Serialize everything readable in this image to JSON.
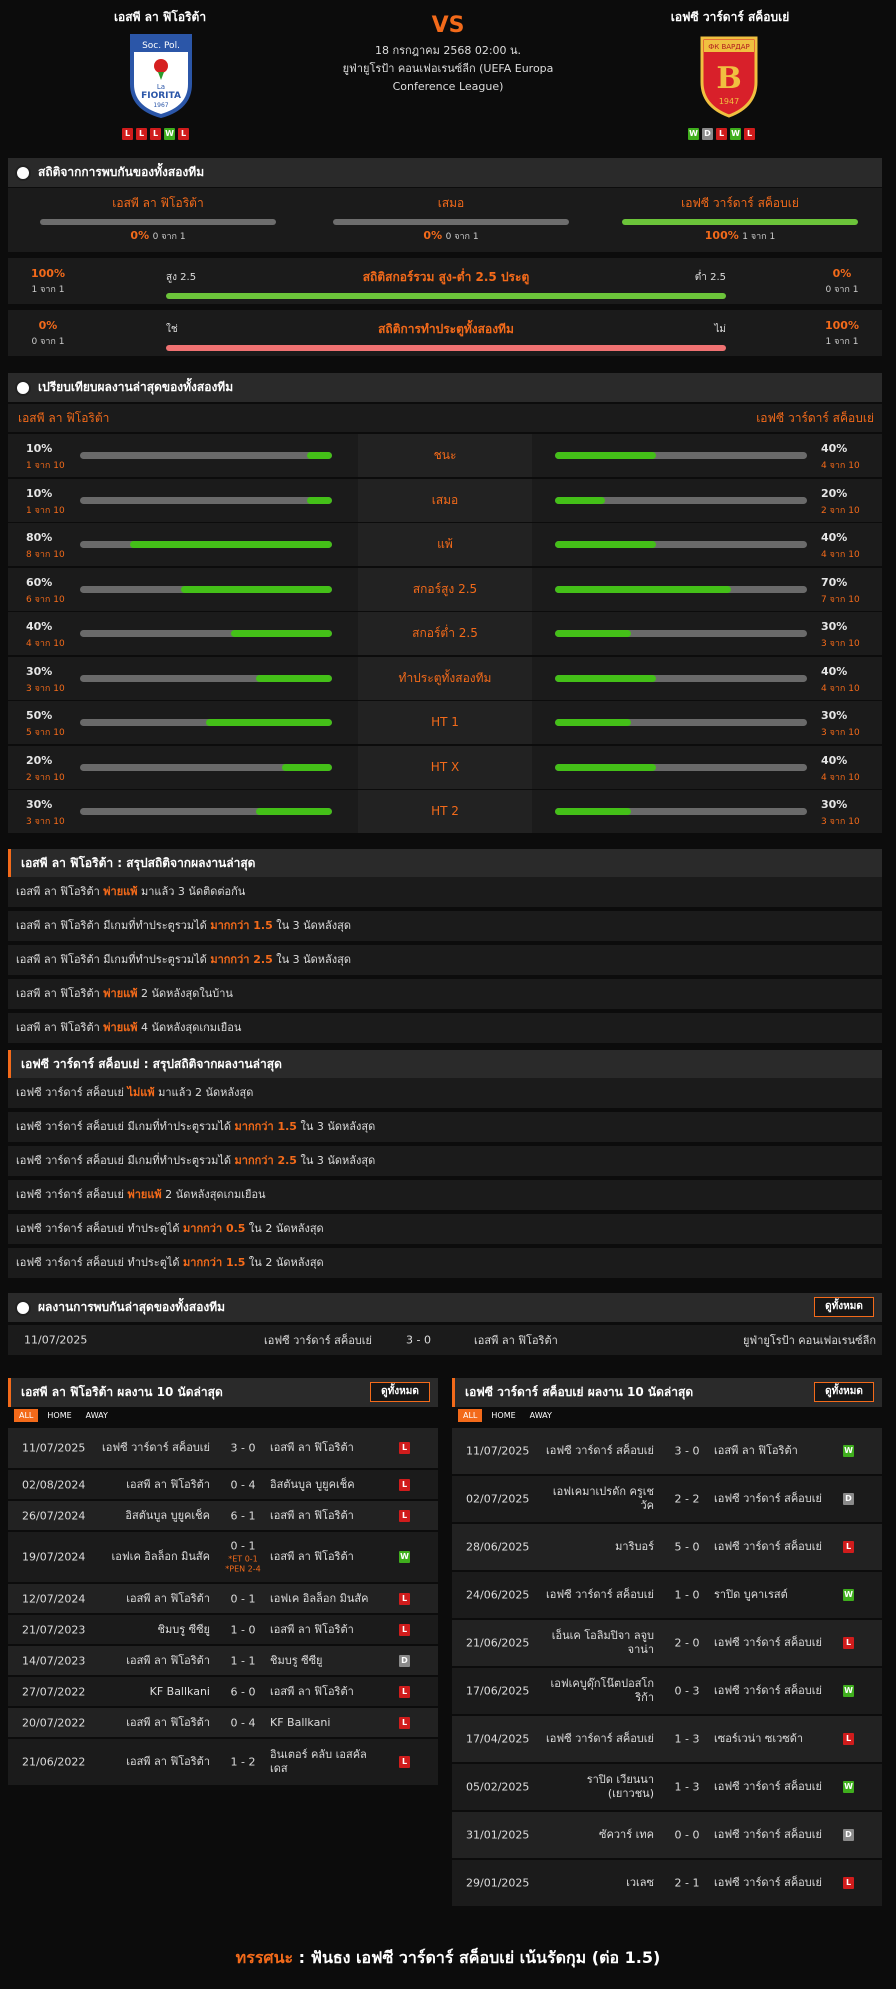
{
  "match": {
    "home": "เอสพี ลา ฟิโอริต้า",
    "away": "เอฟซี วาร์ดาร์ สค็อบเย่",
    "vs": "VS",
    "date": "18 กรกฎาคม 2568 02:00 น.",
    "league": "ยูฟ่ายูโรป้า คอนเฟอเรนซ์ลีก (UEFA Europa Conference League)",
    "home_form": [
      "L",
      "L",
      "L",
      "W",
      "L"
    ],
    "away_form": [
      "W",
      "D",
      "L",
      "W",
      "L"
    ],
    "home_logo_text": [
      "Soc. Pol.",
      "La",
      "FIORITA",
      "1967"
    ],
    "away_logo_text": [
      "ФК ВАРДАР",
      "B",
      "1947"
    ]
  },
  "h2h_stats": {
    "title": "สถิติจากการพบกันของทั้งสองทีม",
    "cols": [
      {
        "name": "เอสพี ลา ฟิโอริต้า",
        "pct": "0%",
        "of": "0 จาก 1",
        "fill": 0
      },
      {
        "name": "เสมอ",
        "pct": "0%",
        "of": "0 จาก 1",
        "fill": 0
      },
      {
        "name": "เอฟซี วาร์ดาร์ สค็อบเย่",
        "pct": "100%",
        "of": "1 จาก 1",
        "fill": 1
      }
    ],
    "ou": {
      "left": "100%",
      "left_of": "1 จาก 1",
      "a": "สูง 2.5",
      "title": "สถิติสกอร์รวม สูง-ต่ำ 2.5 ประตู",
      "b": "ต่ำ 2.5",
      "right": "0%",
      "right_of": "0 จาก 1",
      "color": "#6cc43a"
    },
    "btts": {
      "left": "0%",
      "left_of": "0 จาก 1",
      "a": "ใช่",
      "title": "สถิติการทำประตูทั้งสองทีม",
      "b": "ไม่",
      "right": "100%",
      "right_of": "1 จาก 1",
      "color": "#f07272"
    }
  },
  "compare": {
    "title": "เปรียบเทียบผลงานล่าสุดของทั้งสองทีม",
    "home": "เอสพี ลา ฟิโอริต้า",
    "away": "เอฟซี วาร์ดาร์ สค็อบเย่",
    "rows": [
      {
        "label": "ชนะ",
        "hp": "10%",
        "hof": "1 จาก 10",
        "hv": 0.1,
        "ap": "40%",
        "aof": "4 จาก 10",
        "av": 0.4
      },
      {
        "label": "เสมอ",
        "hp": "10%",
        "hof": "1 จาก 10",
        "hv": 0.1,
        "ap": "20%",
        "aof": "2 จาก 10",
        "av": 0.2
      },
      {
        "label": "แพ้",
        "hp": "80%",
        "hof": "8 จาก 10",
        "hv": 0.8,
        "ap": "40%",
        "aof": "4 จาก 10",
        "av": 0.4
      },
      {
        "label": "สกอร์สูง 2.5",
        "hp": "60%",
        "hof": "6 จาก 10",
        "hv": 0.6,
        "ap": "70%",
        "aof": "7 จาก 10",
        "av": 0.7
      },
      {
        "label": "สกอร์ต่ำ 2.5",
        "hp": "40%",
        "hof": "4 จาก 10",
        "hv": 0.4,
        "ap": "30%",
        "aof": "3 จาก 10",
        "av": 0.3
      },
      {
        "label": "ทำประตูทั้งสองทีม",
        "hp": "30%",
        "hof": "3 จาก 10",
        "hv": 0.3,
        "ap": "40%",
        "aof": "4 จาก 10",
        "av": 0.4
      },
      {
        "label": "HT 1",
        "hp": "50%",
        "hof": "5 จาก 10",
        "hv": 0.5,
        "ap": "30%",
        "aof": "3 จาก 10",
        "av": 0.3
      },
      {
        "label": "HT X",
        "hp": "20%",
        "hof": "2 จาก 10",
        "hv": 0.2,
        "ap": "40%",
        "aof": "4 จาก 10",
        "av": 0.4
      },
      {
        "label": "HT 2",
        "hp": "30%",
        "hof": "3 จาก 10",
        "hv": 0.3,
        "ap": "30%",
        "aof": "3 จาก 10",
        "av": 0.3
      }
    ]
  },
  "home_summary": {
    "title": "เอสพี ลา ฟิโอริต้า : สรุปสถิติจากผลงานล่าสุด",
    "rows": [
      [
        "เอสพี ลา ฟิโอริต้า ",
        "พ่ายแพ้",
        " มาแล้ว 3 นัดติดต่อกัน"
      ],
      [
        "เอสพี ลา ฟิโอริต้า  มีเกมที่ทำประตูรวมได้ ",
        "มากกว่า  1.5",
        " ใน 3 นัดหลังสุด"
      ],
      [
        "เอสพี ลา ฟิโอริต้า  มีเกมที่ทำประตูรวมได้ ",
        "มากกว่า  2.5",
        " ใน 3 นัดหลังสุด"
      ],
      [
        "เอสพี ลา ฟิโอริต้า ",
        "พ่ายแพ้",
        " 2  นัดหลังสุดในบ้าน"
      ],
      [
        "เอสพี ลา ฟิโอริต้า ",
        "พ่ายแพ้",
        " 4  นัดหลังสุดเกมเยือน"
      ]
    ]
  },
  "away_summary": {
    "title": "เอฟซี วาร์ดาร์ สค็อบเย่ : สรุปสถิติจากผลงานล่าสุด",
    "rows": [
      [
        "เอฟซี วาร์ดาร์ สค็อบเย่ ",
        "ไม่แพ้",
        " มาแล้ว 2 นัดหลังสุด"
      ],
      [
        "เอฟซี วาร์ดาร์ สค็อบเย่  มีเกมที่ทำประตูรวมได้ ",
        "มากกว่า  1.5",
        " ใน 3 นัดหลังสุด"
      ],
      [
        "เอฟซี วาร์ดาร์ สค็อบเย่  มีเกมที่ทำประตูรวมได้ ",
        "มากกว่า  2.5",
        " ใน 3 นัดหลังสุด"
      ],
      [
        "เอฟซี วาร์ดาร์ สค็อบเย่ ",
        "พ่ายแพ้",
        " 2  นัดหลังสุดเกมเยือน"
      ],
      [
        "เอฟซี วาร์ดาร์ สค็อบเย่  ทำประตูได้ ",
        "มากกว่า  0.5",
        " ใน 2 นัดหลังสุด"
      ],
      [
        "เอฟซี วาร์ดาร์ สค็อบเย่  ทำประตูได้ ",
        "มากกว่า  1.5",
        " ใน 2 นัดหลังสุด"
      ]
    ]
  },
  "h2h_results": {
    "title": "ผลงานการพบกันล่าสุดของทั้งสองทีม",
    "view_all": "ดูทั้งหมด",
    "rows": [
      {
        "date": "11/07/2025",
        "home": "เอฟซี วาร์ดาร์ สค็อบเย่",
        "score": "3 - 0",
        "away": "เอสพี ลา ฟิโอริต้า",
        "league": "ยูฟ่ายูโรป้า คอนเฟอเรนซ์ลีก"
      }
    ]
  },
  "home_last10": {
    "title": "เอสพี ลา ฟิโอริต้า ผลงาน 10 นัดล่าสุด",
    "view_all": "ดูทั้งหมด",
    "tabs": [
      "ALL",
      "HOME",
      "AWAY"
    ],
    "rows": [
      {
        "date": "11/07/2025",
        "home": "เอฟซี วาร์ดาร์ สค็อบเย่",
        "score": "3 - 0",
        "away": "เอสพี ลา ฟิโอริต้า",
        "r": "L",
        "h": 40
      },
      {
        "date": "02/08/2024",
        "home": "เอสพี ลา ฟิโอริต้า",
        "score": "0 - 4",
        "away": "อิสตันบูล บูยูคเช็ค",
        "r": "L",
        "h": 29
      },
      {
        "date": "26/07/2024",
        "home": "อิสตันบูล บูยูคเช็ค",
        "score": "6 - 1",
        "away": "เอสพี ลา ฟิโอริต้า",
        "r": "L",
        "h": 29
      },
      {
        "date": "19/07/2024",
        "home": "เอฟเค อิลล็อก มินสัค",
        "score": "0 - 1",
        "note": "*ET 0-1 *PEN 2-4",
        "away": "เอสพี ลา ฟิโอริต้า",
        "r": "W",
        "h": 50
      },
      {
        "date": "12/07/2024",
        "home": "เอสพี ลา ฟิโอริต้า",
        "score": "0 - 1",
        "away": "เอฟเค อิลล็อก มินสัค",
        "r": "L",
        "h": 29
      },
      {
        "date": "21/07/2023",
        "home": "ชิมบรู ซีซียู",
        "score": "1 - 0",
        "away": "เอสพี ลา ฟิโอริต้า",
        "r": "L",
        "h": 29
      },
      {
        "date": "14/07/2023",
        "home": "เอสพี ลา ฟิโอริต้า",
        "score": "1 - 1",
        "away": "ชิมบรู ซีซียู",
        "r": "D",
        "h": 29
      },
      {
        "date": "27/07/2022",
        "home": "KF Ballkani",
        "score": "6 - 0",
        "away": "เอสพี ลา ฟิโอริต้า",
        "r": "L",
        "h": 29
      },
      {
        "date": "20/07/2022",
        "home": "เอสพี ลา ฟิโอริต้า",
        "score": "0 - 4",
        "away": "KF Ballkani",
        "r": "L",
        "h": 29
      },
      {
        "date": "21/06/2022",
        "home": "เอสพี ลา ฟิโอริต้า",
        "score": "1 - 2",
        "away": "อินเตอร์ คลับ เอสคัลเดส",
        "r": "L",
        "h": 46
      }
    ]
  },
  "away_last10": {
    "title": "เอฟซี วาร์ดาร์ สค็อบเย่ ผลงาน 10 นัดล่าสุด",
    "view_all": "ดูทั้งหมด",
    "tabs": [
      "ALL",
      "HOME",
      "AWAY"
    ],
    "rows": [
      {
        "date": "11/07/2025",
        "home": "เอฟซี วาร์ดาร์ สค็อบเย่",
        "score": "3 - 0",
        "away": "เอสพี ลา ฟิโอริต้า",
        "r": "W",
        "h": 46
      },
      {
        "date": "02/07/2025",
        "home": "เอฟเคมาเปรดัก ครูเชวัค",
        "score": "2 - 2",
        "away": "เอฟซี วาร์ดาร์ สค็อบเย่",
        "r": "D",
        "h": 46
      },
      {
        "date": "28/06/2025",
        "home": "มาริบอร์",
        "score": "5 - 0",
        "away": "เอฟซี วาร์ดาร์ สค็อบเย่",
        "r": "L",
        "h": 46
      },
      {
        "date": "24/06/2025",
        "home": "เอฟซี วาร์ดาร์ สค็อบเย่",
        "score": "1 - 0",
        "away": "ราปิด บูคาเรสต์",
        "r": "W",
        "h": 46
      },
      {
        "date": "21/06/2025",
        "home": "เอ็นเค โอลิมปิจา ลจูบจาน่า",
        "score": "2 - 0",
        "away": "เอฟซี วาร์ดาร์ สค็อบเย่",
        "r": "L",
        "h": 46
      },
      {
        "date": "17/06/2025",
        "home": "เอฟเคบูดุ๊กโน๊ตปอสโกริก้า",
        "score": "0 - 3",
        "away": "เอฟซี วาร์ดาร์ สค็อบเย่",
        "r": "W",
        "h": 46
      },
      {
        "date": "17/04/2025",
        "home": "เอฟซี วาร์ดาร์ สค็อบเย่",
        "score": "1 - 3",
        "away": "เซอร์เวน่า ซเวซด้า",
        "r": "L",
        "h": 46
      },
      {
        "date": "05/02/2025",
        "home": "ราปิด เวียนนา (เยาวชน)",
        "score": "1 - 3",
        "away": "เอฟซี วาร์ดาร์ สค็อบเย่",
        "r": "W",
        "h": 46
      },
      {
        "date": "31/01/2025",
        "home": "ซัควาร์ เทค",
        "score": "0 - 0",
        "away": "เอฟซี วาร์ดาร์ สค็อบเย่",
        "r": "D",
        "h": 46
      },
      {
        "date": "29/01/2025",
        "home": "เวเลซ",
        "score": "2 - 1",
        "away": "เอฟซี วาร์ดาร์ สค็อบเย่",
        "r": "L",
        "h": 46
      }
    ]
  },
  "prediction": {
    "label": "ทรรศนะ",
    "sep": " :  ",
    "text": "ฟันธง เอฟซี วาร์ดาร์ สค็อบเย่ เน้นรัดกุม (ต่อ 1.5)"
  }
}
